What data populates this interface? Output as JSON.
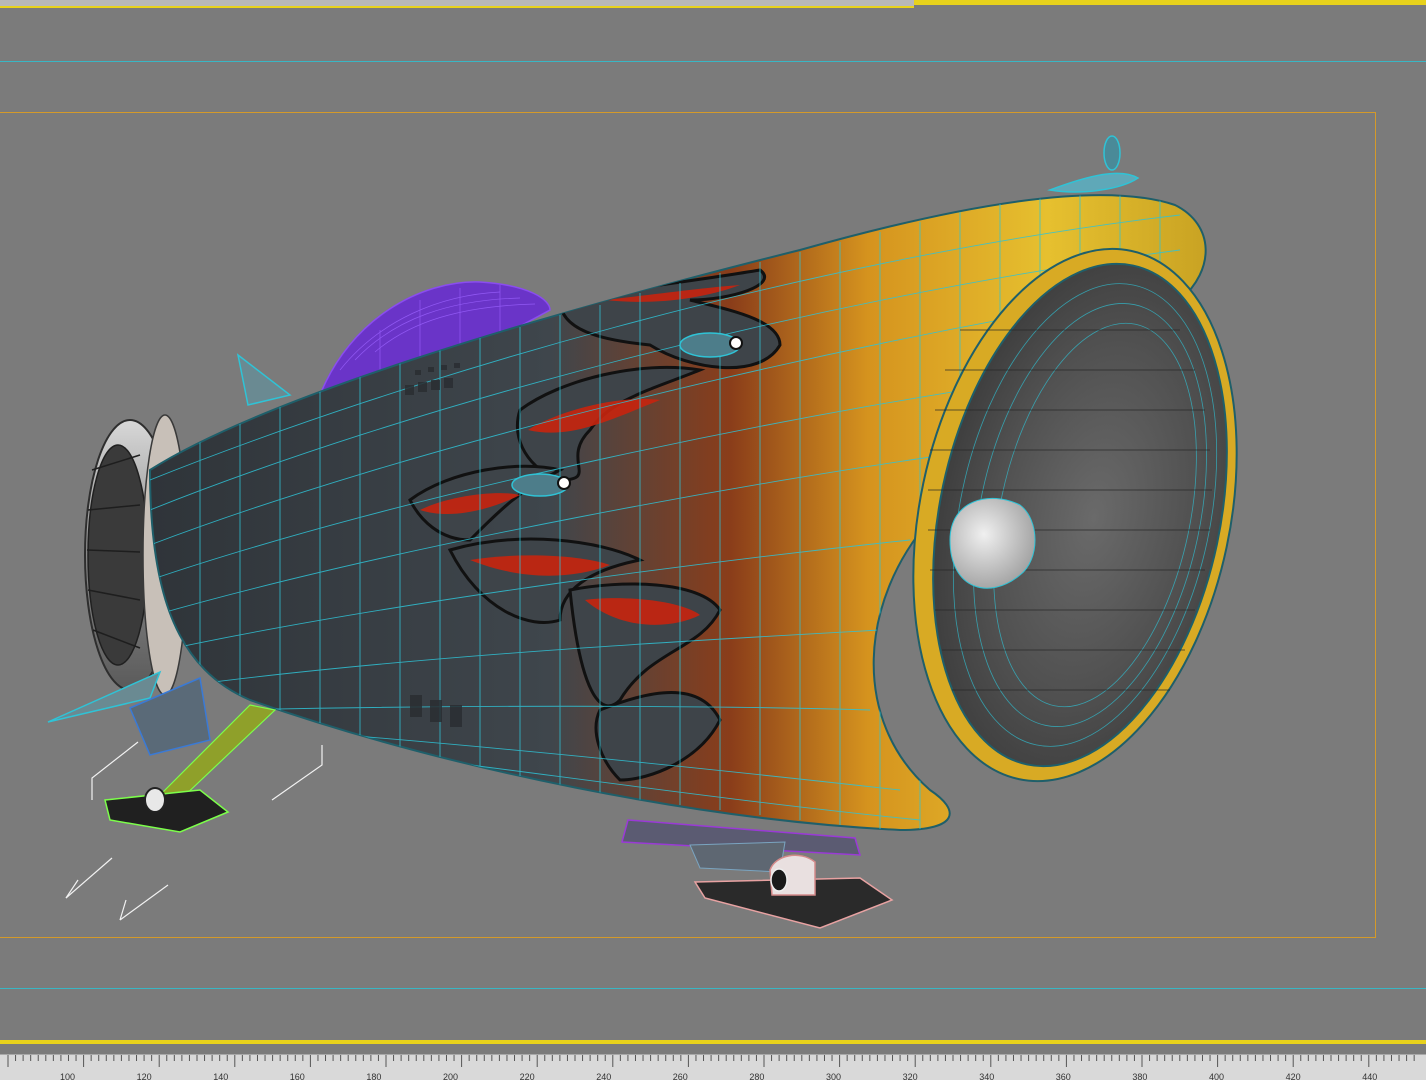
{
  "viewport": {
    "model_name": "",
    "colors": {
      "background": "#7b7b7b",
      "safe_frame": "#39b6c4",
      "render_frame": "#d49a2a",
      "active_border": "#e8d21c",
      "wireframe": "#2fc3d6",
      "body_dark": "#3d4348",
      "paint_yellow": "#e0b22a",
      "flame_red": "#c82a10",
      "canopy": "#7a2fd6"
    }
  },
  "timeline": {
    "ruler_labels": [
      "100",
      "120",
      "140",
      "160",
      "180",
      "200",
      "220",
      "240",
      "260",
      "280",
      "300",
      "320",
      "340",
      "360",
      "380",
      "400",
      "420",
      "440"
    ]
  }
}
